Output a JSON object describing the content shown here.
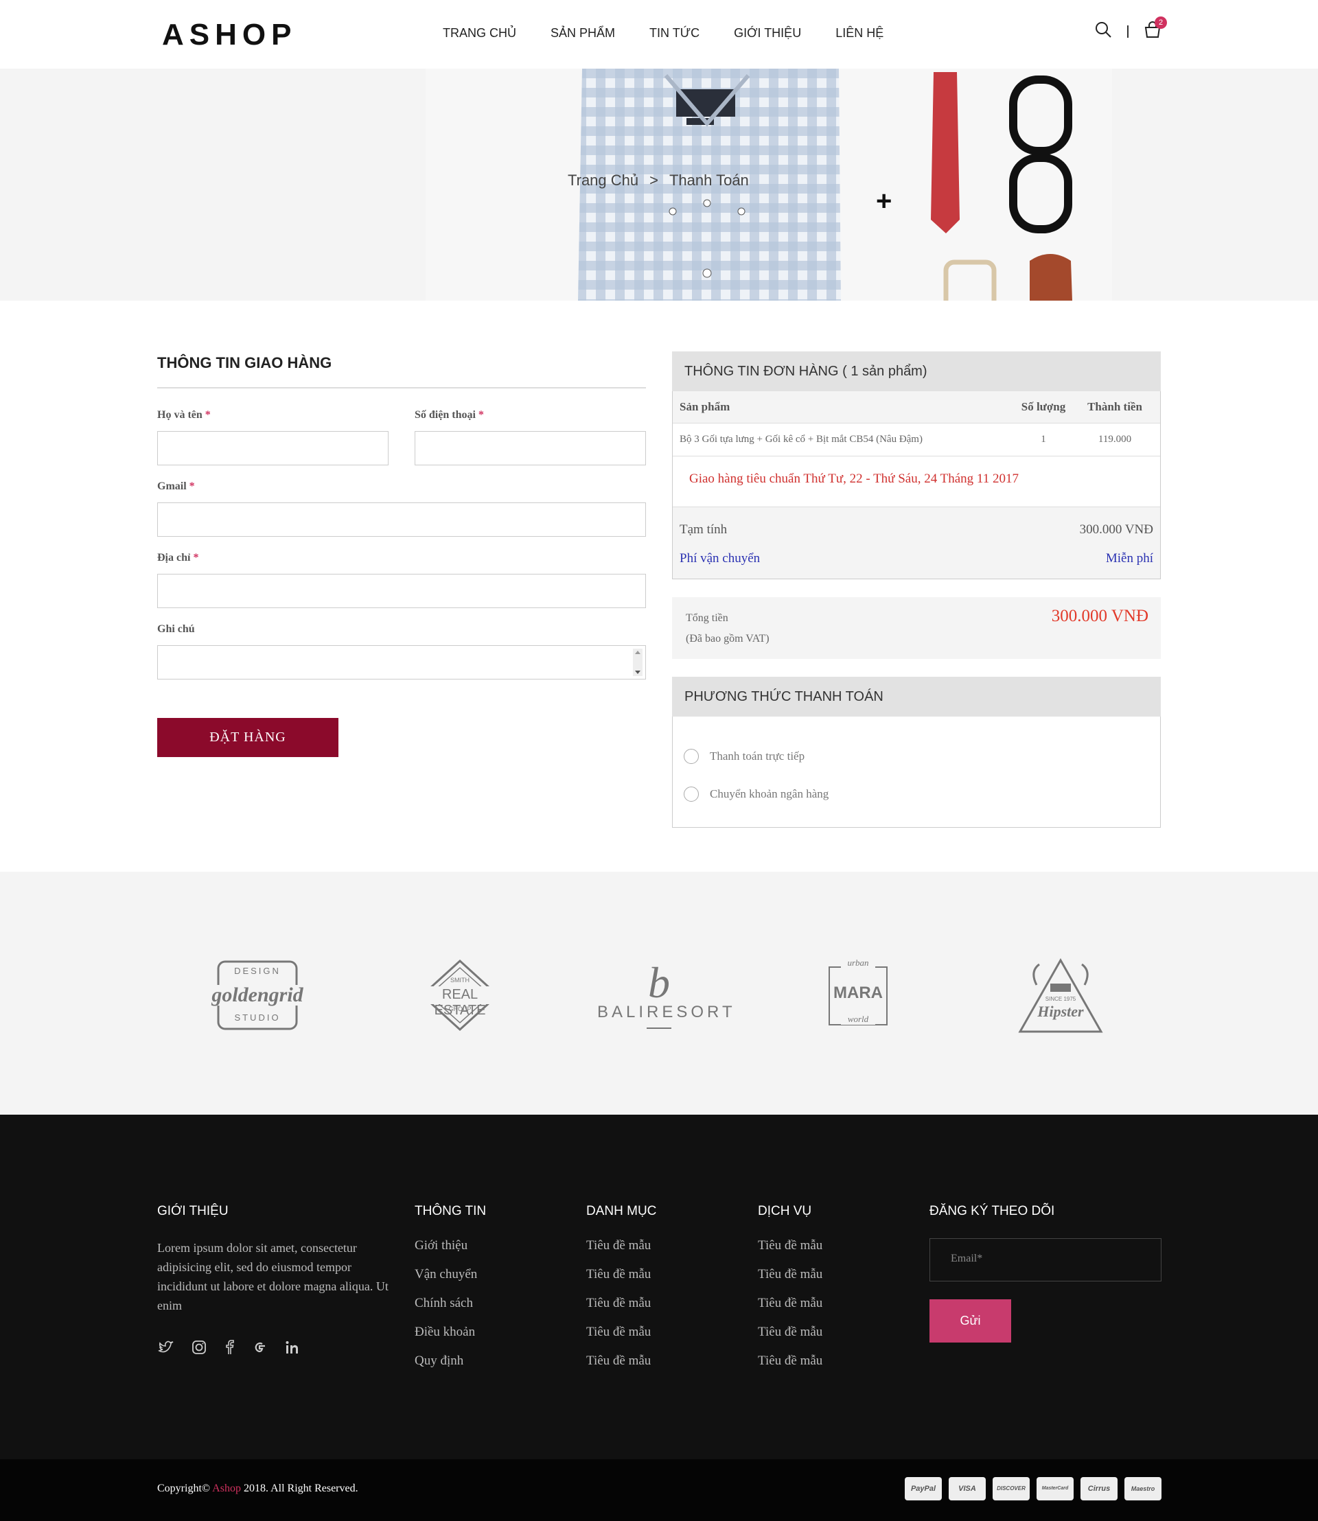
{
  "brand": "ASHOP",
  "nav": [
    "TRANG CHỦ",
    "SẢN PHẨM",
    "TIN TỨC",
    "GIỚI THIỆU",
    "LIÊN HỆ"
  ],
  "cart_count": "2",
  "breadcrumb": {
    "home": "Trang Chủ",
    "sep": ">",
    "current": "Thanh Toán"
  },
  "shipping_form": {
    "title": "THÔNG TIN GIAO HÀNG",
    "name_label": "Họ và tên",
    "phone_label": "Số điện thoại",
    "gmail_label": "Gmail",
    "address_label": "Địa chỉ",
    "note_label": "Ghi chú",
    "required_mark": "*",
    "submit": "ĐẶT HÀNG"
  },
  "order": {
    "title": "THÔNG TIN ĐƠN HÀNG ( 1 sản phẩm)",
    "col_product": "Sản phẩm",
    "col_qty": "Số lượng",
    "col_total": "Thành tiền",
    "items": [
      {
        "name": "Bộ 3 Gối tựa lưng + Gối kê cổ + Bịt mắt CB54 (Nâu Đậm)",
        "qty": "1",
        "price": "119.000"
      }
    ],
    "delivery": "Giao hàng tiêu chuẩn Thứ Tư, 22 - Thứ Sáu, 24 Tháng 11 2017",
    "subtotal_label": "Tạm tính",
    "subtotal": "300.000 VNĐ",
    "shipping_label": "Phí vận chuyển",
    "shipping": "Miễn phí",
    "total_label": "Tổng tiền",
    "vat_note": "(Đã bao gồm VAT)",
    "total": "300.000 VNĐ"
  },
  "payment": {
    "title": "PHƯƠNG THỨC THANH TOÁN",
    "options": [
      "Thanh toán trực tiếp",
      "Chuyển khoản ngân hàng"
    ]
  },
  "partners": [
    {
      "top": "DESIGN",
      "main": "goldengrid",
      "bottom": "STUDIO"
    },
    {
      "top": "SMITH",
      "main": "REAL ESTATE",
      "bottom": "GROUP"
    },
    {
      "top": "b",
      "main": "BALIRESORT",
      "bottom": ""
    },
    {
      "top": "urban",
      "main": "MARA",
      "bottom": "world"
    },
    {
      "top": "SINCE 1975",
      "main": "Hipster",
      "bottom": ""
    }
  ],
  "footer": {
    "about_title": "GIỚI THIỆU",
    "about_text": "Lorem ipsum dolor sit amet, consectetur adipisicing elit, sed do eiusmod tempor incididunt ut labore et dolore magna aliqua. Ut enim",
    "info_title": "THÔNG TIN",
    "info_links": [
      "Giới thiệu",
      "Vận chuyển",
      "Chính sách",
      "Điều khoản",
      "Quy định"
    ],
    "cat_title": "DANH MỤC",
    "cat_links": [
      "Tiêu đề mẫu",
      "Tiêu đề mẫu",
      "Tiêu đề mẫu",
      "Tiêu đề mẫu",
      "Tiêu đề mẫu"
    ],
    "svc_title": "DỊCH VỤ",
    "svc_links": [
      "Tiêu đề mẫu",
      "Tiêu đề mẫu",
      "Tiêu đề mẫu",
      "Tiêu đề mẫu",
      "Tiêu đề mẫu"
    ],
    "subscribe_title": "ĐĂNG KÝ THEO DÕI",
    "email_placeholder": "Email*",
    "send": "Gửi",
    "copyright_pre": "Copyright©",
    "copyright_brand": "Ashop",
    "copyright_post": "2018. All Right Reserved.",
    "cards": [
      "PayPal",
      "VISA",
      "DISCOVER",
      "MasterCard",
      "Cirrus",
      "Maestro"
    ]
  },
  "colors": {
    "accent": "#d0315f",
    "order_button": "#8b0a2b",
    "total": "#e23a2a",
    "shipping": "#2b32b2"
  }
}
